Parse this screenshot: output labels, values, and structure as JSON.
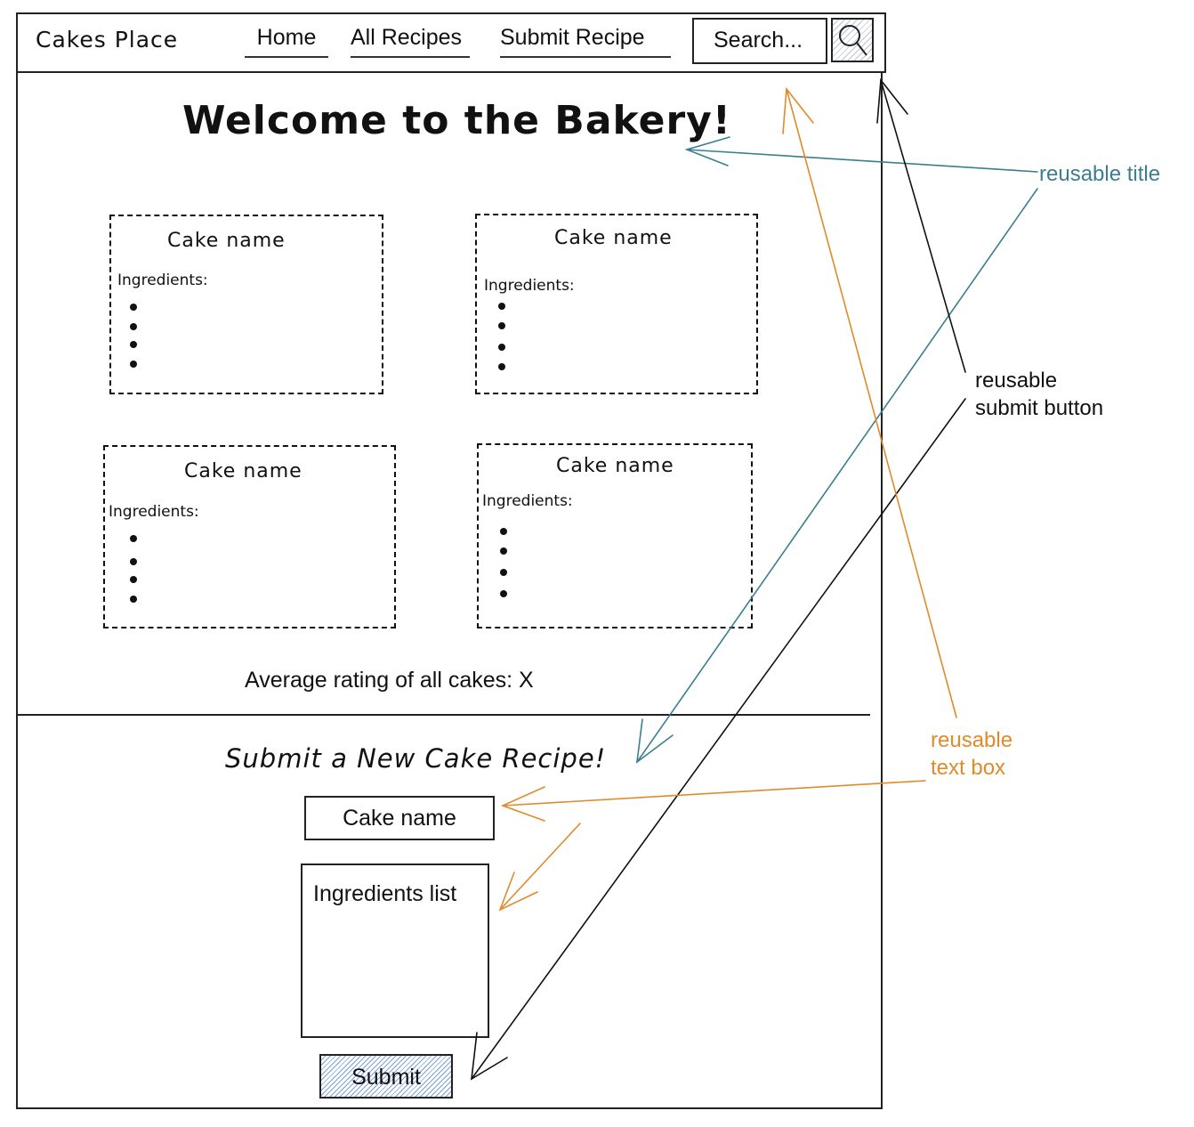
{
  "nav": {
    "brand": "Cakes Place",
    "links": [
      "Home",
      "All Recipes",
      "Submit Recipe"
    ],
    "search_placeholder": "Search..."
  },
  "main": {
    "title": "Welcome to the Bakery!",
    "cards": [
      {
        "name": "Cake name",
        "ingredients_label": "Ingredients:"
      },
      {
        "name": "Cake name",
        "ingredients_label": "Ingredients:"
      },
      {
        "name": "Cake name",
        "ingredients_label": "Ingredients:"
      },
      {
        "name": "Cake name",
        "ingredients_label": "Ingredients:"
      }
    ],
    "average_rating": "Average rating of all cakes: X"
  },
  "form": {
    "title": "Submit a New Cake Recipe!",
    "cake_name_placeholder": "Cake name",
    "ingredients_placeholder": "Ingredients list",
    "submit_label": "Submit"
  },
  "annotations": {
    "reusable_title": "reusable title",
    "reusable_submit_line1": "reusable",
    "reusable_submit_line2": "submit button",
    "reusable_textbox_line1": "reusable",
    "reusable_textbox_line2": "text box",
    "colors": {
      "title": "#3a7e8f",
      "submit": "#111111",
      "textbox": "#e08a2a"
    }
  }
}
